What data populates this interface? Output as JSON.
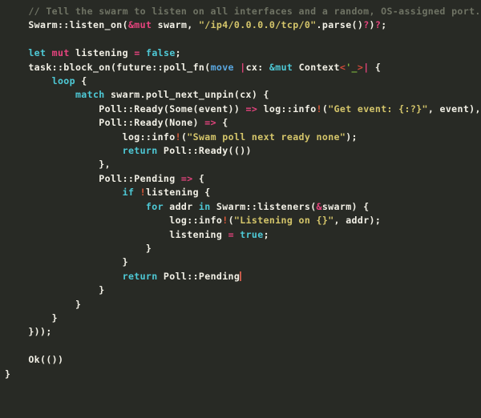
{
  "editor": {
    "language": "rust",
    "background_color": "#282a25",
    "foreground_color": "#f2f0e6",
    "colors": {
      "comment": "#6f7364",
      "keyword": "#4ec9d6",
      "keyword_move": "#5aa7e0",
      "operator_pink": "#e8447f",
      "string": "#d4c56a",
      "macro_bang": "#e05a3a",
      "angle_bracket": "#d44a3a",
      "lifetime": "#7fb83f",
      "caret": "#c75a4a"
    },
    "caret_after_text": "Poll::Pending",
    "lines": [
      {
        "indent": "    ",
        "tokens": [
          {
            "text": "// Tell the swarm to listen on all interfaces and a random, OS-assigned port.",
            "type": "comment"
          }
        ]
      },
      {
        "indent": "    ",
        "tokens": [
          {
            "text": "Swarm::listen_on(",
            "type": "plain"
          },
          {
            "text": "&",
            "type": "op"
          },
          {
            "text": "mut",
            "type": "mut"
          },
          {
            "text": " swarm, ",
            "type": "plain"
          },
          {
            "text": "\"/ip4/0.0.0.0/tcp/0\"",
            "type": "str"
          },
          {
            "text": ".parse()",
            "type": "plain"
          },
          {
            "text": "?",
            "type": "op"
          },
          {
            "text": ")",
            "type": "plain"
          },
          {
            "text": "?",
            "type": "op"
          },
          {
            "text": ";",
            "type": "plain"
          }
        ]
      },
      {
        "indent": "",
        "tokens": []
      },
      {
        "indent": "    ",
        "tokens": [
          {
            "text": "let",
            "type": "kw"
          },
          {
            "text": " ",
            "type": "plain"
          },
          {
            "text": "mut",
            "type": "mut"
          },
          {
            "text": " listening ",
            "type": "plain"
          },
          {
            "text": "=",
            "type": "op"
          },
          {
            "text": " ",
            "type": "plain"
          },
          {
            "text": "false",
            "type": "kw"
          },
          {
            "text": ";",
            "type": "plain"
          }
        ]
      },
      {
        "indent": "    ",
        "tokens": [
          {
            "text": "task::block_on(future::poll_fn(",
            "type": "plain"
          },
          {
            "text": "move",
            "type": "kw2"
          },
          {
            "text": " ",
            "type": "plain"
          },
          {
            "text": "|",
            "type": "op"
          },
          {
            "text": "cx: ",
            "type": "plain"
          },
          {
            "text": "&mut",
            "type": "amp-cy"
          },
          {
            "text": " Context",
            "type": "plain"
          },
          {
            "text": "<",
            "type": "angle"
          },
          {
            "text": "'_",
            "type": "life"
          },
          {
            "text": ">",
            "type": "angle"
          },
          {
            "text": "|",
            "type": "op"
          },
          {
            "text": " {",
            "type": "plain"
          }
        ]
      },
      {
        "indent": "        ",
        "tokens": [
          {
            "text": "loop",
            "type": "kw"
          },
          {
            "text": " {",
            "type": "plain"
          }
        ]
      },
      {
        "indent": "            ",
        "tokens": [
          {
            "text": "match",
            "type": "kw"
          },
          {
            "text": " swarm.poll_next_unpin(cx) {",
            "type": "plain"
          }
        ]
      },
      {
        "indent": "                ",
        "tokens": [
          {
            "text": "Poll::Ready(Some(event)) ",
            "type": "plain"
          },
          {
            "text": "=>",
            "type": "arrow"
          },
          {
            "text": " log::info",
            "type": "plain"
          },
          {
            "text": "!",
            "type": "macro"
          },
          {
            "text": "(",
            "type": "plain"
          },
          {
            "text": "\"Get event: {:?}\"",
            "type": "str"
          },
          {
            "text": ", event),",
            "type": "plain"
          }
        ]
      },
      {
        "indent": "                ",
        "tokens": [
          {
            "text": "Poll::Ready(None) ",
            "type": "plain"
          },
          {
            "text": "=>",
            "type": "arrow"
          },
          {
            "text": " {",
            "type": "plain"
          }
        ]
      },
      {
        "indent": "                    ",
        "tokens": [
          {
            "text": "log::info",
            "type": "plain"
          },
          {
            "text": "!",
            "type": "macro"
          },
          {
            "text": "(",
            "type": "plain"
          },
          {
            "text": "\"Swam poll next ready none\"",
            "type": "str"
          },
          {
            "text": ");",
            "type": "plain"
          }
        ]
      },
      {
        "indent": "                    ",
        "tokens": [
          {
            "text": "return",
            "type": "kw"
          },
          {
            "text": " Poll::Ready(())",
            "type": "plain"
          }
        ]
      },
      {
        "indent": "                ",
        "tokens": [
          {
            "text": "},",
            "type": "plain"
          }
        ]
      },
      {
        "indent": "                ",
        "tokens": [
          {
            "text": "Poll::Pending ",
            "type": "plain"
          },
          {
            "text": "=>",
            "type": "arrow"
          },
          {
            "text": " {",
            "type": "plain"
          }
        ]
      },
      {
        "indent": "                    ",
        "tokens": [
          {
            "text": "if",
            "type": "kw"
          },
          {
            "text": " ",
            "type": "plain"
          },
          {
            "text": "!",
            "type": "macro"
          },
          {
            "text": "listening {",
            "type": "plain"
          }
        ]
      },
      {
        "indent": "                        ",
        "tokens": [
          {
            "text": "for",
            "type": "kw"
          },
          {
            "text": " addr ",
            "type": "plain"
          },
          {
            "text": "in",
            "type": "kw"
          },
          {
            "text": " Swarm::listeners(",
            "type": "plain"
          },
          {
            "text": "&",
            "type": "op"
          },
          {
            "text": "swarm) {",
            "type": "plain"
          }
        ]
      },
      {
        "indent": "                            ",
        "tokens": [
          {
            "text": "log::info",
            "type": "plain"
          },
          {
            "text": "!",
            "type": "macro"
          },
          {
            "text": "(",
            "type": "plain"
          },
          {
            "text": "\"Listening on {}\"",
            "type": "str"
          },
          {
            "text": ", addr);",
            "type": "plain"
          }
        ]
      },
      {
        "indent": "                            ",
        "tokens": [
          {
            "text": "listening ",
            "type": "plain"
          },
          {
            "text": "=",
            "type": "op"
          },
          {
            "text": " ",
            "type": "plain"
          },
          {
            "text": "true",
            "type": "kw"
          },
          {
            "text": ";",
            "type": "plain"
          }
        ]
      },
      {
        "indent": "                        ",
        "tokens": [
          {
            "text": "}",
            "type": "plain"
          }
        ]
      },
      {
        "indent": "                    ",
        "tokens": [
          {
            "text": "}",
            "type": "plain"
          }
        ]
      },
      {
        "indent": "                    ",
        "tokens": [
          {
            "text": "return",
            "type": "kw"
          },
          {
            "text": " Poll::Pending",
            "type": "plain",
            "caret": true
          }
        ]
      },
      {
        "indent": "                ",
        "tokens": [
          {
            "text": "}",
            "type": "plain"
          }
        ]
      },
      {
        "indent": "            ",
        "tokens": [
          {
            "text": "}",
            "type": "plain"
          }
        ]
      },
      {
        "indent": "        ",
        "tokens": [
          {
            "text": "}",
            "type": "plain"
          }
        ]
      },
      {
        "indent": "    ",
        "tokens": [
          {
            "text": "}));",
            "type": "plain"
          }
        ]
      },
      {
        "indent": "",
        "tokens": []
      },
      {
        "indent": "    ",
        "tokens": [
          {
            "text": "Ok(())",
            "type": "plain"
          }
        ]
      },
      {
        "indent": "",
        "tokens": [
          {
            "text": "}",
            "type": "plain"
          }
        ]
      }
    ]
  }
}
